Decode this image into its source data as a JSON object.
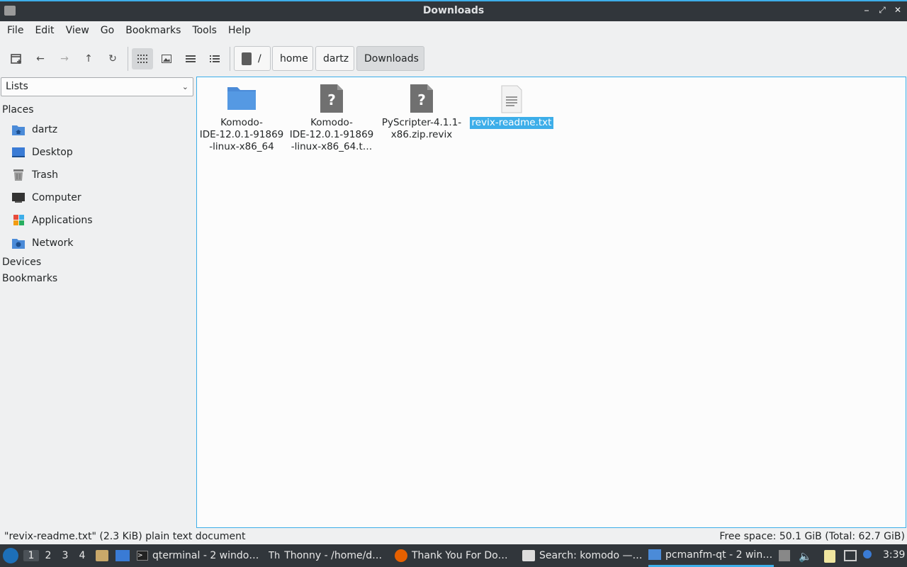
{
  "window": {
    "title": "Downloads"
  },
  "menu": [
    "File",
    "Edit",
    "View",
    "Go",
    "Bookmarks",
    "Tools",
    "Help"
  ],
  "breadcrumb": {
    "root": "/",
    "parts": [
      "home",
      "dartz",
      "Downloads"
    ]
  },
  "sidebar": {
    "view_mode": "Lists",
    "places_label": "Places",
    "places": [
      {
        "label": "dartz",
        "icon": "home-folder-icon"
      },
      {
        "label": "Desktop",
        "icon": "desktop-icon"
      },
      {
        "label": "Trash",
        "icon": "trash-icon"
      },
      {
        "label": "Computer",
        "icon": "computer-icon"
      },
      {
        "label": "Applications",
        "icon": "applications-icon"
      },
      {
        "label": "Network",
        "icon": "network-icon"
      }
    ],
    "devices_label": "Devices",
    "bookmarks_label": "Bookmarks"
  },
  "files": [
    {
      "name": "Komodo-IDE-12.0.1-91869-linux-x86_64",
      "line1": "Komodo-",
      "line2": "IDE-12.0.1-91869",
      "line3": "-linux-x86_64",
      "type": "folder"
    },
    {
      "name": "Komodo-IDE-12.0.1-91869-linux-x86_64.t…",
      "line1": "Komodo-",
      "line2": "IDE-12.0.1-91869",
      "line3": "-linux-x86_64.t…",
      "type": "unknown"
    },
    {
      "name": "PyScripter-4.1.1-x86.zip.revix",
      "line1": "PyScripter-4.1.1-",
      "line2": "x86.zip.revix",
      "line3": "",
      "type": "unknown"
    },
    {
      "name": "revix-readme.txt",
      "line1": "revix-readme.txt",
      "type": "text",
      "selected": true
    }
  ],
  "status": {
    "left": "\"revix-readme.txt\" (2.3 KiB) plain text document",
    "right": "Free space: 50.1 GiB (Total: 62.7 GiB)"
  },
  "taskbar": {
    "workspaces": [
      "1",
      "2",
      "3",
      "4"
    ],
    "tasks": [
      {
        "label": "qterminal - 2 windo…",
        "icon": "terminal-icon"
      },
      {
        "label": "Thonny  -  /home/d…",
        "icon": "thonny-icon"
      },
      {
        "label": "Thank You For Do…",
        "icon": "firefox-icon"
      },
      {
        "label": "Search: komodo —…",
        "icon": "search-app-icon"
      },
      {
        "label": "pcmanfm-qt - 2 win…",
        "icon": "folder-icon"
      }
    ],
    "clock": "3:39"
  },
  "colors": {
    "accent": "#3daee9",
    "titlebar": "#31363b",
    "folder": "#4b8bd8"
  }
}
